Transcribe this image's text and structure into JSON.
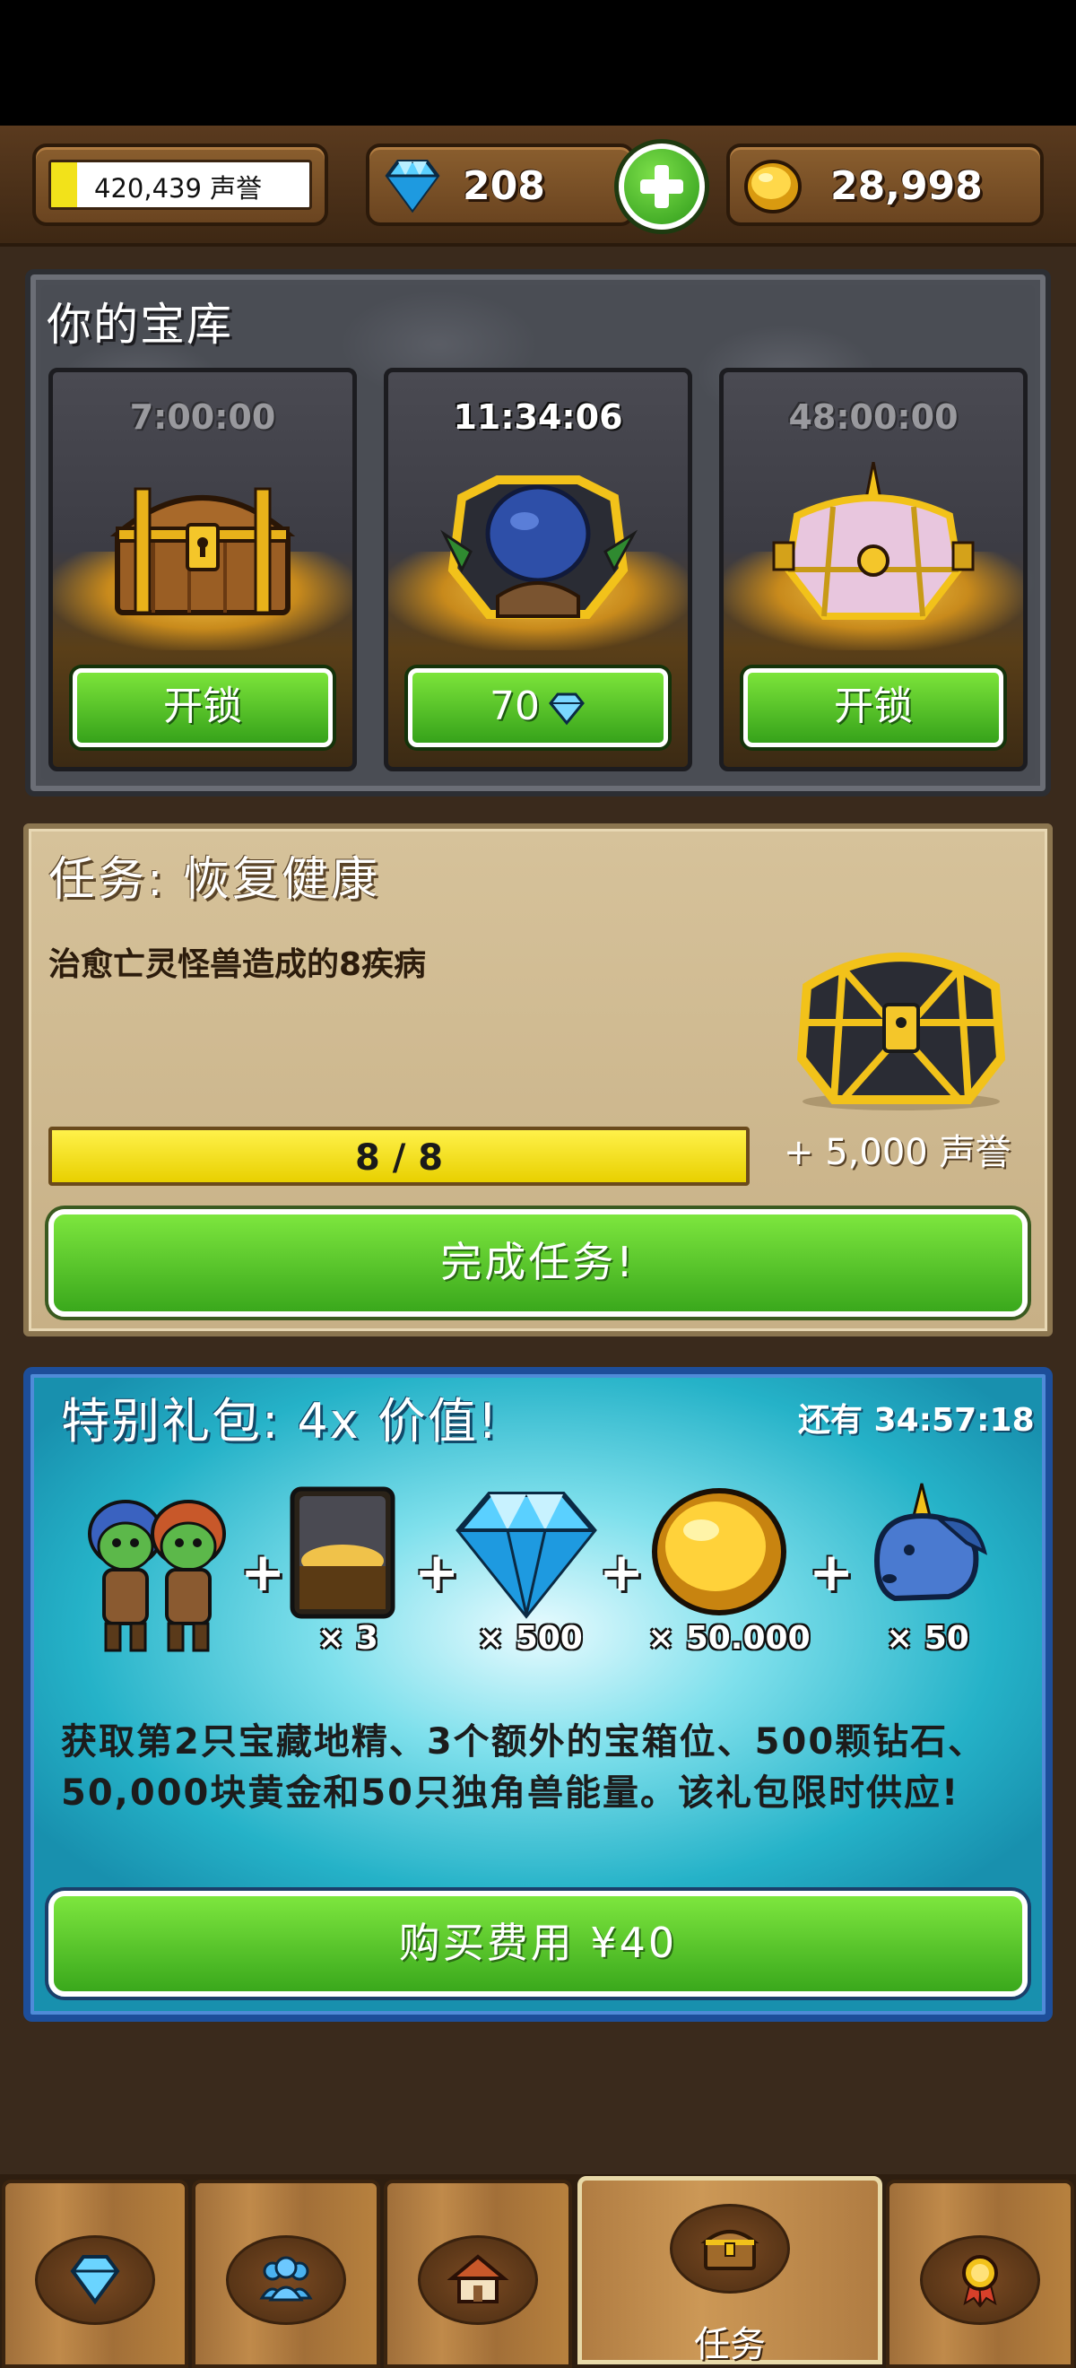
{
  "header": {
    "reputation_value": "420,439 声誉",
    "reputation_fill": 0.1,
    "gems": "208",
    "gold": "28,998"
  },
  "vault": {
    "title": "你的宝库",
    "slots": [
      {
        "timer": "7:00:00",
        "button": "开锁",
        "chest": "wooden-chest"
      },
      {
        "timer": "11:34:06",
        "button": "70",
        "chest": "gold-chest-with-goblin"
      },
      {
        "timer": "48:00:00",
        "button": "开锁",
        "chest": "unicorn-chest"
      }
    ]
  },
  "quest": {
    "title": "任务: 恢复健康",
    "description": "治愈亡灵怪兽造成的8疾病",
    "progress_text": "8 / 8",
    "progress": 1.0,
    "reward": "+ 5,000 声誉",
    "button": "完成任务!"
  },
  "offer": {
    "title": "特别礼包: 4x 价值!",
    "timer": "还有 34:57:18",
    "items": [
      {
        "icon": "goblins",
        "qty": ""
      },
      {
        "icon": "chest-slot-card",
        "qty": "× 3"
      },
      {
        "icon": "diamond",
        "qty": "× 500"
      },
      {
        "icon": "gold-coin",
        "qty": "× 50.000"
      },
      {
        "icon": "unicorn",
        "qty": "× 50"
      }
    ],
    "plus": "+",
    "description": "获取第2只宝藏地精、3个额外的宝箱位、500颗钻石、50,000块黄金和50只独角兽能量。该礼包限时供应!",
    "button": "购买费用 ¥40"
  },
  "nav": {
    "tabs": [
      {
        "icon": "gem-icon",
        "label": ""
      },
      {
        "icon": "friends-icon",
        "label": ""
      },
      {
        "icon": "village-icon",
        "label": ""
      },
      {
        "icon": "chest-icon",
        "label": "任务",
        "active": true
      },
      {
        "icon": "medal-icon",
        "label": ""
      }
    ]
  },
  "colors": {
    "button_green": "#4cbf26",
    "panel_teal": "#25b2c8",
    "parchment": "#d6c29a",
    "wood": "#6a4420"
  }
}
